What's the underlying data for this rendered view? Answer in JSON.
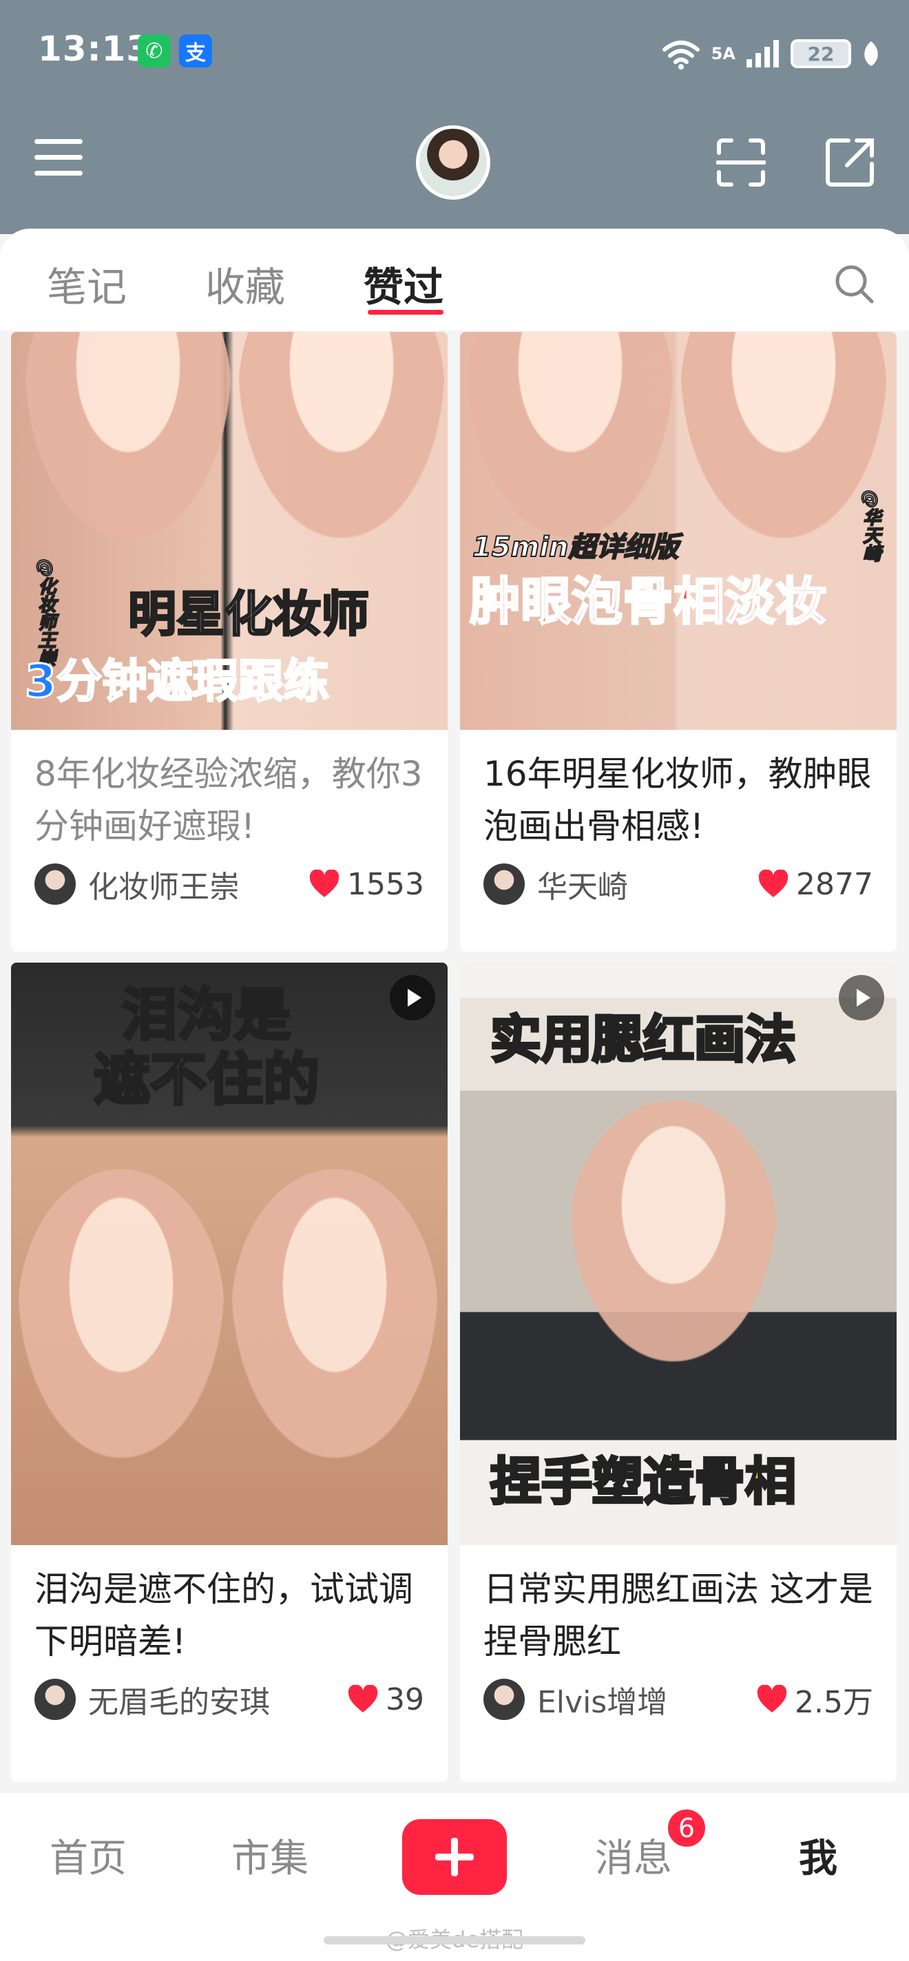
{
  "status_bar": {
    "time": "13:13",
    "wechat_badge": "✆",
    "alipay_badge": "支",
    "network_label": "5A",
    "battery_level": "22"
  },
  "header": {
    "menu_icon": "hamburger-icon",
    "scan_icon": "scan-icon",
    "share_icon": "share-icon"
  },
  "tabs": {
    "notes": "笔记",
    "favorites": "收藏",
    "liked": "赞过",
    "active": "赞过"
  },
  "feed": {
    "cards": [
      {
        "overlay_mini": "@化妆师王崇",
        "overlay_line1": "明星化妆师",
        "overlay_line2": "3分钟遮瑕跟练",
        "title": "8年化妆经验浓缩，教你3分钟画好遮瑕!",
        "author": "化妆师王崇",
        "likes": "1553"
      },
      {
        "overlay_mini": "@华天崎",
        "overlay_line1": "15min超详细版",
        "overlay_line2": "肿眼泡骨相淡妆",
        "title": "16年明星化妆师，教肿眼泡画出骨相感!",
        "author": "华天崎",
        "likes": "2877"
      },
      {
        "overlay_line1": "泪沟是",
        "overlay_line2": "遮不住的",
        "title": "泪沟是遮不住的，试试调下明暗差!",
        "author": "无眉毛的安琪",
        "likes": "39"
      },
      {
        "overlay_line1": "实用腮红画法",
        "overlay_line2": "捏手塑造骨相",
        "title": "日常实用腮红画法 这才是捏骨腮红",
        "author": "Elvis增增",
        "likes": "2.5万"
      }
    ]
  },
  "bottom_nav": {
    "home": "首页",
    "market": "市集",
    "messages": "消息",
    "messages_badge": "6",
    "me": "我"
  },
  "watermark": "@爱美de搭配",
  "colors": {
    "accent": "#ff2442",
    "header_bg": "#7b8c97"
  }
}
